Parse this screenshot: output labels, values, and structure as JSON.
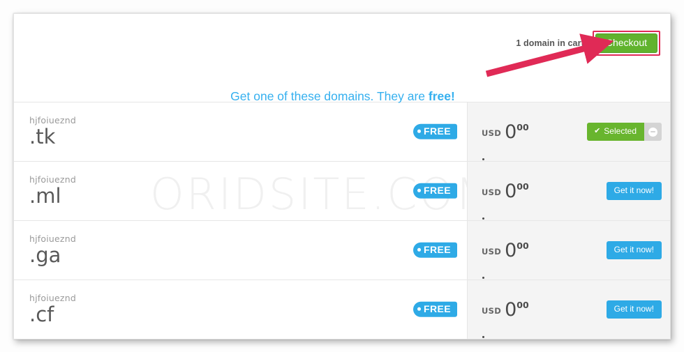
{
  "cart": {
    "count_label": "1 domain in cart",
    "checkout_label": "Checkout",
    "checkout_color": "#61b32e",
    "highlight_color": "#e02a56"
  },
  "promo": {
    "text_lead": "Get one of these domains. They are ",
    "text_emphasis": "free!",
    "color": "#35b0ef"
  },
  "watermark": {
    "text": "ORIDSITE.COM"
  },
  "results": {
    "free_tag_label": "FREE",
    "currency": "USD",
    "rows": [
      {
        "domain": "hjfoiueznd",
        "tld": ".tk",
        "tag": "FREE",
        "currency": "USD",
        "amount": "0",
        "cents": "00",
        "action_label": "Selected",
        "action_state": "selected",
        "remove_label": "Remove"
      },
      {
        "domain": "hjfoiueznd",
        "tld": ".ml",
        "tag": "FREE",
        "currency": "USD",
        "amount": "0",
        "cents": "00",
        "action_label": "Get it now!",
        "action_state": "available",
        "remove_label": ""
      },
      {
        "domain": "hjfoiueznd",
        "tld": ".ga",
        "tag": "FREE",
        "currency": "USD",
        "amount": "0",
        "cents": "00",
        "action_label": "Get it now!",
        "action_state": "available",
        "remove_label": ""
      },
      {
        "domain": "hjfoiueznd",
        "tld": ".cf",
        "tag": "FREE",
        "currency": "USD",
        "amount": "0",
        "cents": "00",
        "action_label": "Get it now!",
        "action_state": "available",
        "remove_label": ""
      }
    ]
  }
}
